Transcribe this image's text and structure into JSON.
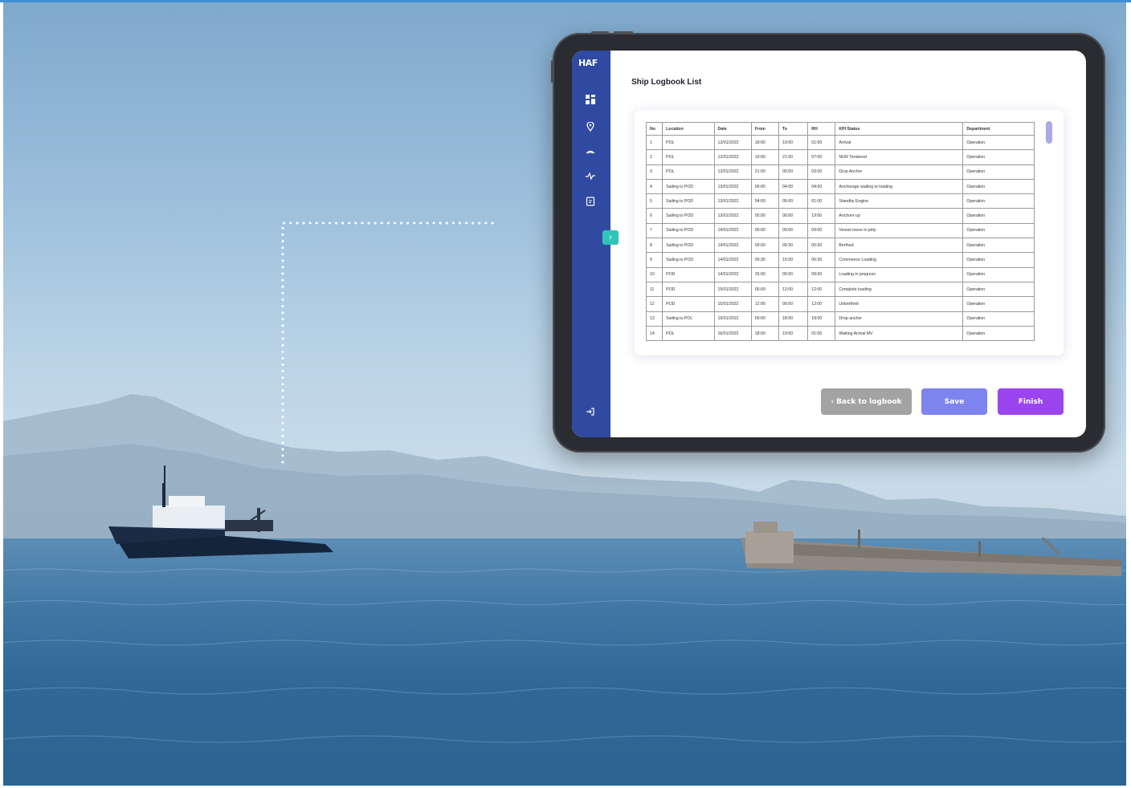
{
  "app": {
    "logo": "HAF",
    "page_title": "Ship Logbook List"
  },
  "sidebar": {
    "items": [
      {
        "icon": "dashboard-icon"
      },
      {
        "icon": "location-pin-icon"
      },
      {
        "icon": "ship-icon"
      },
      {
        "icon": "activity-icon"
      },
      {
        "icon": "report-icon"
      }
    ],
    "logout_icon": "logout-icon",
    "collapse_icon": "chevron-right-icon"
  },
  "table": {
    "headers": [
      "No",
      "Location",
      "Date",
      "From",
      "To",
      "RH",
      "KPI Status",
      "Department"
    ],
    "rows": [
      [
        "1",
        "POL",
        "12/01/2022",
        "18:00",
        "19:00",
        "01:00",
        "Arrival",
        "Operation"
      ],
      [
        "2",
        "POL",
        "12/01/2022",
        "19:00",
        "21:00",
        "07:00",
        "NOR Tendered",
        "Operation"
      ],
      [
        "3",
        "POL",
        "12/01/2022",
        "21:00",
        "00:00",
        "03:00",
        "Drop Anchor",
        "Operation"
      ],
      [
        "4",
        "Sailing to POD",
        "13/01/2022",
        "00:00",
        "04:00",
        "04:00",
        "Anchorage waiting to loading",
        "Operation"
      ],
      [
        "5",
        "Sailing to POD",
        "13/01/2022",
        "04:00",
        "05:00",
        "01:00",
        "Standby Engine",
        "Operation"
      ],
      [
        "6",
        "Sailing to POD",
        "13/01/2022",
        "05:00",
        "00:00",
        "19:00",
        "Anchore up",
        "Operation"
      ],
      [
        "7",
        "Sailing to POD",
        "14/01/2022",
        "00:00",
        "09:00",
        "09:00",
        "Vessel move to jetty",
        "Operation"
      ],
      [
        "8",
        "Sailing to POD",
        "14/01/2022",
        "09:00",
        "09:30",
        "00:30",
        "Berthed",
        "Operation"
      ],
      [
        "9",
        "Sailing to POD",
        "14/01/2022",
        "09:30",
        "15:00",
        "06:30",
        "Commence Loading",
        "Operation"
      ],
      [
        "10",
        "POD",
        "14/01/2022",
        "15:00",
        "00:00",
        "09:00",
        "Loading in progress",
        "Operation"
      ],
      [
        "11",
        "POD",
        "15/01/2022",
        "00:00",
        "12:00",
        "12:00",
        "Complete loading",
        "Operation"
      ],
      [
        "12",
        "POD",
        "15/01/2022",
        "12:00",
        "00:00",
        "12:00",
        "Unberthed",
        "Operation"
      ],
      [
        "13",
        "Sailing to POL",
        "16/01/2022",
        "00:00",
        "18:00",
        "18:00",
        "Drop anchor",
        "Operation"
      ],
      [
        "14",
        "POL",
        "16/01/2022",
        "18:00",
        "19:00",
        "01:00",
        "Waiting Arrival MV",
        "Operation"
      ]
    ]
  },
  "buttons": {
    "back": "‹ Back to logbook",
    "save": "Save",
    "finish": "Finish"
  },
  "colors": {
    "sidebar": "#2f4aa0",
    "save": "#7d84ef",
    "finish": "#9b45ef",
    "back": "#a3a3a3",
    "collapse": "#2fc4b8"
  }
}
